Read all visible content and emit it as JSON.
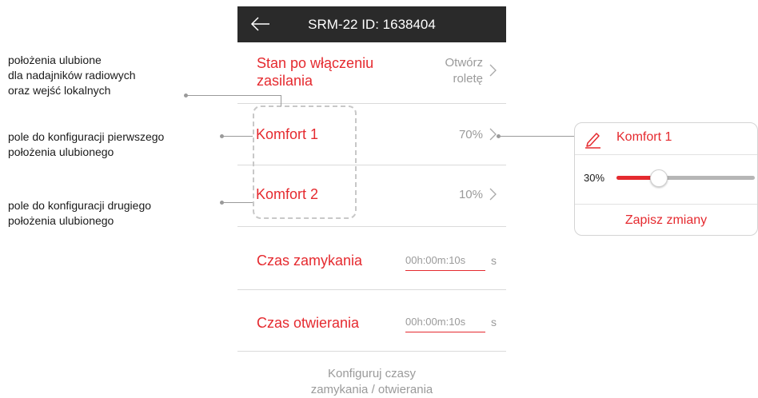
{
  "header": {
    "title": "SRM-22 ID: 1638404",
    "back_icon": "arrow-left-icon"
  },
  "rows": {
    "power_on_state": {
      "label_line1": "Stan po włączeniu",
      "label_line2": "zasilania",
      "value_line1": "Otwórz",
      "value_line2": "roletę"
    },
    "comfort1": {
      "label": "Komfort 1",
      "value": "70%"
    },
    "comfort2": {
      "label": "Komfort 2",
      "value": "10%"
    },
    "closing_time": {
      "label": "Czas zamykania",
      "value": "00h:00m:10s",
      "unit": "s"
    },
    "opening_time": {
      "label": "Czas otwierania",
      "value": "00h:00m:10s",
      "unit": "s"
    }
  },
  "footer": {
    "line1": "Konfiguruj czasy",
    "line2": "zamykania / otwierania"
  },
  "annotations": {
    "favorites": {
      "line1": "położenia ulubione",
      "line2": "dla nadajników radiowych",
      "line3": "oraz wejść lokalnych"
    },
    "first": {
      "line1": "pole do konfiguracji pierwszego",
      "line2": "położenia ulubionego"
    },
    "second": {
      "line1": "pole do konfiguracji drugiego",
      "line2": "położenia ulubionego"
    }
  },
  "popup": {
    "title": "Komfort 1",
    "edit_icon": "pencil-icon",
    "slider_value_label": "30%",
    "slider_level": 0.3,
    "save_label": "Zapisz zmiany"
  },
  "colors": {
    "accent": "#e52a2f",
    "header_bg": "#2a2a2a",
    "muted": "#9a9a9a"
  }
}
